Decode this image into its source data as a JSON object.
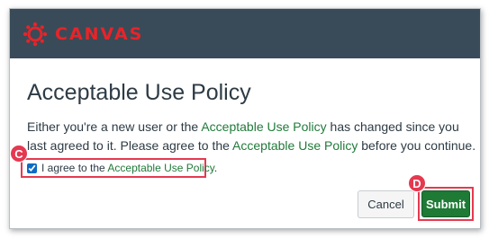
{
  "header": {
    "logo_text": "CANVAS",
    "logo_color": "#e72429",
    "background": "#394b58"
  },
  "dialog": {
    "title": "Acceptable Use Policy",
    "message_part1": "Either you're a new user or the ",
    "message_link1": "Acceptable Use Policy",
    "message_part2": " has changed since you last agreed to it. Please agree to the ",
    "message_link2": "Acceptable Use Policy",
    "message_part3": " before you continue."
  },
  "agreement": {
    "checked": true,
    "label_prefix": "I agree to the ",
    "label_link": "Acceptable Use Policy",
    "label_suffix": "."
  },
  "buttons": {
    "cancel_label": "Cancel",
    "submit_label": "Submit"
  },
  "annotations": {
    "marker_c": "C",
    "marker_d": "D",
    "highlight_color": "#e53950"
  }
}
